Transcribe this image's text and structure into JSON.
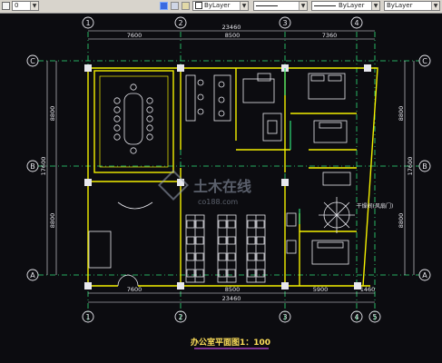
{
  "toolbar": {
    "layer_value": "0",
    "color_value": "ByLayer",
    "linetype_value": "ByLayer",
    "lineweight_value": "ByLayer"
  },
  "drawing": {
    "title": "办公室平面图1：100",
    "grid_columns": [
      "1",
      "2",
      "3",
      "4",
      "5"
    ],
    "grid_rows": [
      "A",
      "B",
      "C"
    ],
    "top_total": "23460",
    "top_segments": [
      "7600",
      "8500",
      "7360"
    ],
    "bottom_total": "23460",
    "bottom_segments": [
      "7600",
      "8500",
      "5900",
      "1460"
    ],
    "left_total": "17600",
    "left_segments": [
      "8800",
      "8800"
    ],
    "right_total": "17600",
    "right_segments": [
      "8800",
      "8800"
    ],
    "room_label": "干燥间(风扇门)",
    "watermark_text": "土木在线",
    "watermark_url": "co188.com"
  },
  "colors": {
    "background": "#0c0c10",
    "grid": "#2fe07a",
    "wall": "#f4f000",
    "furniture": "#e8e8ee",
    "dimension": "#e8e8ee",
    "title_color": "#ffe05a"
  }
}
